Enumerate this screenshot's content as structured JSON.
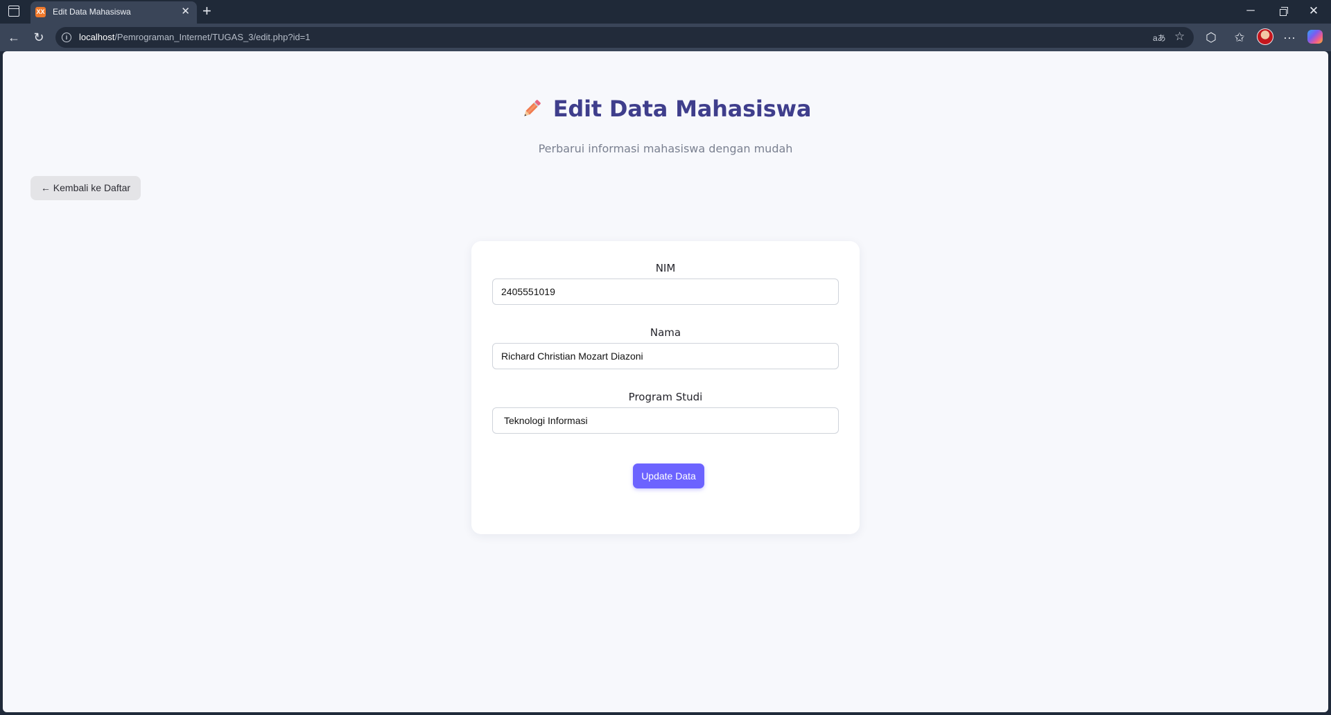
{
  "browser": {
    "tab_title": "Edit Data Mahasiswa",
    "tab_favicon_text": "XX",
    "tab_close": "✕",
    "new_tab": "+",
    "url_host": "localhost",
    "url_path": "/Pemrograman_Internet/TUGAS_3/edit.php?id=1",
    "controls": {
      "minimize": "─",
      "close": "✕"
    },
    "nav": {
      "back": "←",
      "reload": "↻"
    },
    "address_icons": {
      "read_aloud": "aあ",
      "favorite": "☆"
    },
    "toolbar_icons": {
      "extensions": "⬡",
      "favorites": "✩",
      "more": "···"
    }
  },
  "page": {
    "title": "Edit Data Mahasiswa",
    "subtitle": "Perbarui informasi mahasiswa dengan mudah",
    "back_button": "← Kembali ke Daftar",
    "form": {
      "nim": {
        "label": "NIM",
        "value": "2405551019"
      },
      "nama": {
        "label": "Nama",
        "value": "Richard Christian Mozart Diazoni"
      },
      "prodi": {
        "label": "Program Studi",
        "value": "Teknologi Informasi"
      },
      "submit": "Update Data"
    }
  },
  "colors": {
    "title": "#3f3e8c",
    "accent": "#6c63ff",
    "page_bg": "#f7f8fc",
    "pencil": "#f07b4f"
  }
}
